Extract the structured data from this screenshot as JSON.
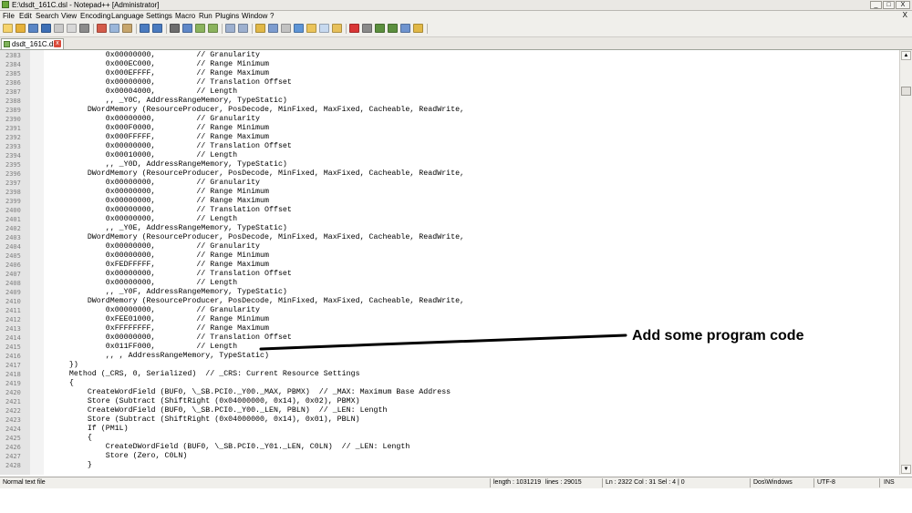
{
  "window": {
    "title": "E:\\dsdt_161C.dsl - Notepad++ [Administrator]",
    "min": "_",
    "max": "□",
    "close": "X"
  },
  "menu": {
    "items": [
      "File",
      "Edit",
      "Search",
      "View",
      "Encoding",
      "Language",
      "Settings",
      "Macro",
      "Run",
      "Plugins",
      "Window",
      "?"
    ],
    "close": "X"
  },
  "toolbar": {
    "icons": [
      "new-file-icon",
      "open-file-icon",
      "save-icon",
      "save-all-icon",
      "close-file-icon",
      "close-all-icon",
      "print-icon",
      "cut-icon",
      "copy-icon",
      "paste-icon",
      "undo-icon",
      "redo-icon",
      "find-icon",
      "replace-icon",
      "zoom-in-icon",
      "zoom-out-icon",
      "sync-vertical-icon",
      "sync-horizontal-icon",
      "word-wrap-icon",
      "show-all-chars-icon",
      "indent-guide-icon",
      "user-language-icon",
      "doc-map-icon",
      "function-list-icon",
      "folder-workspace-icon",
      "record-macro-icon",
      "stop-macro-icon",
      "play-macro-icon",
      "run-macro-multiple-icon",
      "save-macro-icon",
      "find-in-files-icon"
    ]
  },
  "tab": {
    "label": "dsdt_161C.dsl",
    "close": "x"
  },
  "editor": {
    "lines": [
      {
        "n": "2383",
        "t": "            0x00000000,         // Granularity"
      },
      {
        "n": "2384",
        "t": "            0x000EC000,         // Range Minimum"
      },
      {
        "n": "2385",
        "t": "            0x000EFFFF,         // Range Maximum"
      },
      {
        "n": "2386",
        "t": "            0x00000000,         // Translation Offset"
      },
      {
        "n": "2387",
        "t": "            0x00004000,         // Length"
      },
      {
        "n": "2388",
        "t": "            ,, _Y0C, AddressRangeMemory, TypeStatic)"
      },
      {
        "n": "2389",
        "t": "        DWordMemory (ResourceProducer, PosDecode, MinFixed, MaxFixed, Cacheable, ReadWrite,"
      },
      {
        "n": "2390",
        "t": "            0x00000000,         // Granularity"
      },
      {
        "n": "2391",
        "t": "            0x000F0000,         // Range Minimum"
      },
      {
        "n": "2392",
        "t": "            0x000FFFFF,         // Range Maximum"
      },
      {
        "n": "2393",
        "t": "            0x00000000,         // Translation Offset"
      },
      {
        "n": "2394",
        "t": "            0x00010000,         // Length"
      },
      {
        "n": "2395",
        "t": "            ,, _Y0D, AddressRangeMemory, TypeStatic)"
      },
      {
        "n": "2396",
        "t": "        DWordMemory (ResourceProducer, PosDecode, MinFixed, MaxFixed, Cacheable, ReadWrite,"
      },
      {
        "n": "2397",
        "t": "            0x00000000,         // Granularity"
      },
      {
        "n": "2398",
        "t": "            0x00000000,         // Range Minimum"
      },
      {
        "n": "2399",
        "t": "            0x00000000,         // Range Maximum"
      },
      {
        "n": "2400",
        "t": "            0x00000000,         // Translation Offset"
      },
      {
        "n": "2401",
        "t": "            0x00000000,         // Length"
      },
      {
        "n": "2402",
        "t": "            ,, _Y0E, AddressRangeMemory, TypeStatic)"
      },
      {
        "n": "2403",
        "t": "        DWordMemory (ResourceProducer, PosDecode, MinFixed, MaxFixed, Cacheable, ReadWrite,"
      },
      {
        "n": "2404",
        "t": "            0x00000000,         // Granularity"
      },
      {
        "n": "2405",
        "t": "            0x00000000,         // Range Minimum"
      },
      {
        "n": "2406",
        "t": "            0xFEDFFFFF,         // Range Maximum"
      },
      {
        "n": "2407",
        "t": "            0x00000000,         // Translation Offset"
      },
      {
        "n": "2408",
        "t": "            0x00000000,         // Length"
      },
      {
        "n": "2409",
        "t": "            ,, _Y0F, AddressRangeMemory, TypeStatic)"
      },
      {
        "n": "2410",
        "t": "        DWordMemory (ResourceProducer, PosDecode, MinFixed, MaxFixed, Cacheable, ReadWrite,"
      },
      {
        "n": "2411",
        "t": "            0x00000000,         // Granularity"
      },
      {
        "n": "2412",
        "t": "            0xFEE01000,         // Range Minimum"
      },
      {
        "n": "2413",
        "t": "            0xFFFFFFFF,         // Range Maximum"
      },
      {
        "n": "2414",
        "t": "            0x00000000,         // Translation Offset"
      },
      {
        "n": "2415",
        "t": "            0x011FF000,         // Length"
      },
      {
        "n": "2416",
        "t": "            ,, , AddressRangeMemory, TypeStatic)"
      },
      {
        "n": "2417",
        "t": "    })"
      },
      {
        "n": "2418",
        "t": "    Method (_CRS, 0, Serialized)  // _CRS: Current Resource Settings"
      },
      {
        "n": "2419",
        "t": "    {"
      },
      {
        "n": "2420",
        "t": "        CreateWordField (BUF0, \\_SB.PCI0._Y00._MAX, PBMX)  // _MAX: Maximum Base Address"
      },
      {
        "n": "2421",
        "t": "        Store (Subtract (ShiftRight (0x04000000, 0x14), 0x02), PBMX)"
      },
      {
        "n": "2422",
        "t": "        CreateWordField (BUF0, \\_SB.PCI0._Y00._LEN, PBLN)  // _LEN: Length"
      },
      {
        "n": "2423",
        "t": "        Store (Subtract (ShiftRight (0x04000000, 0x14), 0x01), PBLN)"
      },
      {
        "n": "2424",
        "t": "        If (PM1L)"
      },
      {
        "n": "2425",
        "t": "        {"
      },
      {
        "n": "2426",
        "t": "            CreateDWordField (BUF0, \\_SB.PCI0._Y01._LEN, C0LN)  // _LEN: Length"
      },
      {
        "n": "2427",
        "t": "            Store (Zero, C0LN)"
      },
      {
        "n": "2428",
        "t": "        }"
      }
    ]
  },
  "annotation": {
    "text": "Add some program code"
  },
  "statusbar": {
    "file_type": "Normal text file",
    "length": "length : 1031219",
    "lines": "lines : 29015",
    "position": "Ln : 2322   Col : 31   Sel : 4 | 0",
    "eol": "Dos\\Windows",
    "encoding": "UTF-8",
    "mode": "INS"
  },
  "colors": {
    "annotation_line": "#000000",
    "gutter": "#e4e4e4",
    "chrome": "#f0efeb"
  }
}
